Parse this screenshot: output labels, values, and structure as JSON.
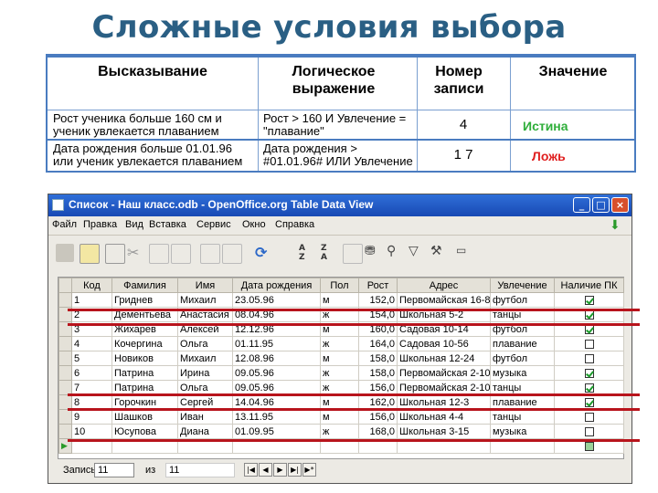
{
  "slide": {
    "title": "Сложные условия выбора"
  },
  "conditions": {
    "headers": [
      "Высказывание",
      "Логическое выражение",
      "Номер записи",
      "Значение"
    ],
    "rows": [
      {
        "statement": "Рост ученика больше 160 см и ученик увлекается плаванием",
        "expression": "Рост > 160 И Увлечение = \"плавание\"",
        "records": "4",
        "value": "Истина"
      },
      {
        "statement": "Дата рождения больше 01.01.96 или ученик увлекается плаванием",
        "expression": "Дата рождения > #01.01.96# ИЛИ Увлечение = \"плавание\"",
        "records": "1 7",
        "value": "Ложь"
      }
    ]
  },
  "window": {
    "title": "Список - Наш класс.odb - OpenOffice.org Table Data View",
    "menu": [
      "Файл",
      "Правка",
      "Вид",
      "Вставка",
      "Сервис",
      "Окно",
      "Справка"
    ],
    "columns": [
      "",
      "Код",
      "Фамилия",
      "Имя",
      "Дата рождения",
      "Пол",
      "Рост",
      "Адрес",
      "Увлечение",
      "Наличие ПК"
    ],
    "rows": [
      {
        "code": "1",
        "surname": "Гриднев",
        "name": "Михаил",
        "birth": "23.05.96",
        "sex": "м",
        "height": "152,0",
        "address": "Первомайская 16-8",
        "hobby": "футбол",
        "pc": true
      },
      {
        "code": "2",
        "surname": "Дементьева",
        "name": "Анастасия",
        "birth": "08.04.96",
        "sex": "ж",
        "height": "154,0",
        "address": "Школьная 5-2",
        "hobby": "танцы",
        "pc": true
      },
      {
        "code": "3",
        "surname": "Жихарев",
        "name": "Алексей",
        "birth": "12.12.96",
        "sex": "м",
        "height": "160,0",
        "address": "Садовая 10-14",
        "hobby": "футбол",
        "pc": true
      },
      {
        "code": "4",
        "surname": "Кочергина",
        "name": "Ольга",
        "birth": "01.11.95",
        "sex": "ж",
        "height": "164,0",
        "address": "Садовая 10-56",
        "hobby": "плавание",
        "pc": false
      },
      {
        "code": "5",
        "surname": "Новиков",
        "name": "Михаил",
        "birth": "12.08.96",
        "sex": "м",
        "height": "158,0",
        "address": "Школьная 12-24",
        "hobby": "футбол",
        "pc": false
      },
      {
        "code": "6",
        "surname": "Патрина",
        "name": "Ирина",
        "birth": "09.05.96",
        "sex": "ж",
        "height": "158,0",
        "address": "Первомайская 2-10",
        "hobby": "музыка",
        "pc": true
      },
      {
        "code": "7",
        "surname": "Патрина",
        "name": "Ольга",
        "birth": "09.05.96",
        "sex": "ж",
        "height": "156,0",
        "address": "Первомайская 2-10",
        "hobby": "танцы",
        "pc": true
      },
      {
        "code": "8",
        "surname": "Горочкин",
        "name": "Сергей",
        "birth": "14.04.96",
        "sex": "м",
        "height": "162,0",
        "address": "Школьная 12-3",
        "hobby": "плавание",
        "pc": true
      },
      {
        "code": "9",
        "surname": "Шашков",
        "name": "Иван",
        "birth": "13.11.95",
        "sex": "м",
        "height": "156,0",
        "address": "Школьная 4-4",
        "hobby": "танцы",
        "pc": false
      },
      {
        "code": "10",
        "surname": "Юсупова",
        "name": "Диана",
        "birth": "01.09.95",
        "sex": "ж",
        "height": "168,0",
        "address": "Школьная 3-15",
        "hobby": "музыка",
        "pc": false
      }
    ],
    "status": {
      "label": "Запись",
      "current": "11",
      "of": "из",
      "total": "11"
    }
  },
  "colors": {
    "title": "#2a5f84",
    "true_value": "#2fae3a",
    "false_value": "#e02020",
    "highlight": "#b8141c",
    "titlebar": "#1849b4"
  }
}
